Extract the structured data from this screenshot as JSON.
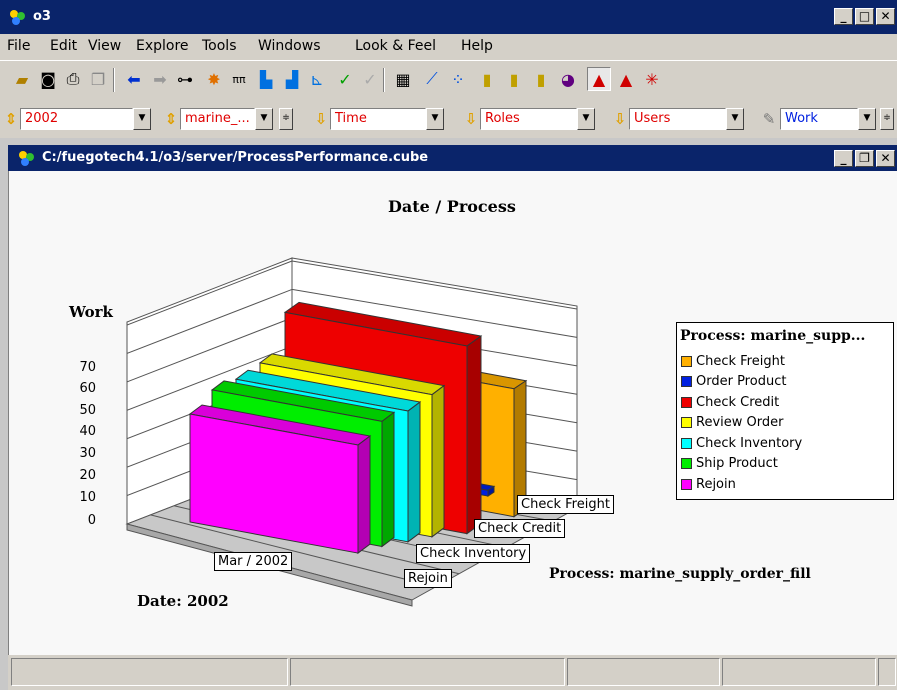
{
  "app": {
    "title": "o3"
  },
  "menu": [
    "File",
    "Edit",
    "View",
    "Explore",
    "Tools",
    "Windows",
    "Look & Feel",
    "Help"
  ],
  "combos": {
    "year": "2002",
    "process": "marine_...",
    "time": "Time",
    "roles": "Roles",
    "users": "Users",
    "measure": "Work"
  },
  "internal_window": {
    "title": "C:/fuegotech4.1/o3/server/ProcessPerformance.cube"
  },
  "chart": {
    "title": "Date / Process",
    "ylabel": "Work",
    "yticks": [
      "70",
      "60",
      "50",
      "40",
      "30",
      "20",
      "10",
      "0"
    ],
    "date_axis_label": "Date: 2002",
    "date_category": "Mar / 2002",
    "process_axis_label": "Process: marine_supply_order_fill",
    "process_tick_labels": [
      "Check Freight",
      "Check Credit",
      "Check Inventory",
      "Rejoin"
    ],
    "legend_title": "Process: marine_supp...",
    "colors": {
      "check_freight": "#ffb000",
      "order_product": "#0020e0",
      "check_credit": "#ee0000",
      "review_order": "#ffff00",
      "check_inventory": "#00ffff",
      "ship_product": "#00ee00",
      "rejoin": "#ff00ff"
    }
  },
  "chart_data": {
    "type": "bar",
    "title": "Date / Process",
    "xlabel": "Date: 2002",
    "ylabel": "Work",
    "categories": [
      "Mar / 2002"
    ],
    "ylim": [
      0,
      70
    ],
    "series": [
      {
        "name": "Check Freight",
        "values": [
          45
        ]
      },
      {
        "name": "Order Product",
        "values": [
          2
        ]
      },
      {
        "name": "Check Credit",
        "values": [
          66
        ]
      },
      {
        "name": "Review Order",
        "values": [
          50
        ]
      },
      {
        "name": "Check Inventory",
        "values": [
          46
        ]
      },
      {
        "name": "Ship Product",
        "values": [
          44
        ]
      },
      {
        "name": "Rejoin",
        "values": [
          38
        ]
      }
    ]
  }
}
